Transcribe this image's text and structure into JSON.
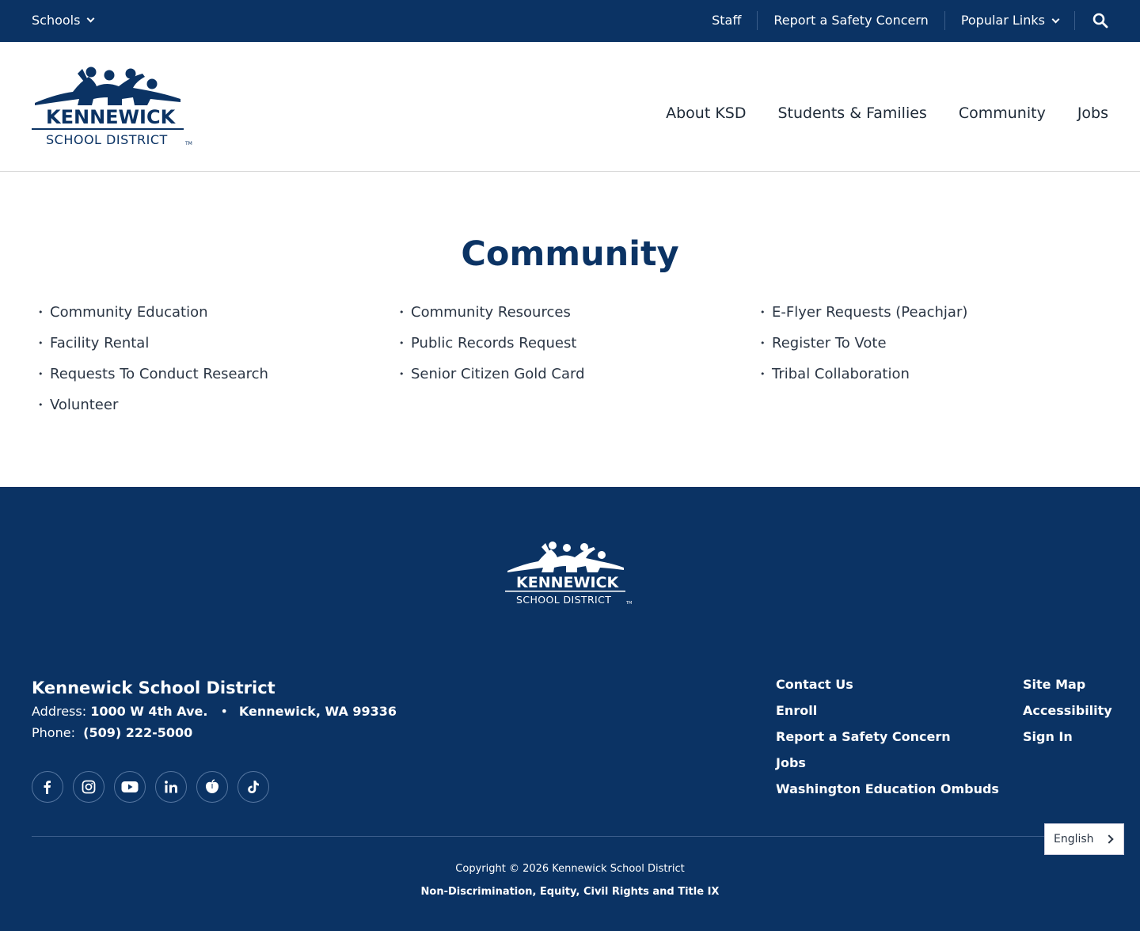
{
  "topbar": {
    "schools_label": "Schools",
    "utility_links": [
      "Staff",
      "Report a Safety Concern",
      "Popular Links"
    ],
    "search_icon": "search-icon"
  },
  "logo": {
    "line1": "KENNEWICK",
    "line2": "SCHOOL DISTRICT",
    "tm": "TM"
  },
  "main_nav": [
    "About KSD",
    "Students & Families",
    "Community",
    "Jobs"
  ],
  "page": {
    "title": "Community",
    "links": [
      "Community Education",
      "Community Resources",
      "E-Flyer Requests (Peachjar)",
      "Facility Rental",
      "Public Records Request",
      "Register To Vote",
      "Requests To Conduct Research",
      "Senior Citizen Gold Card",
      "Tribal Collaboration",
      "Volunteer"
    ]
  },
  "footer": {
    "district_name": "Kennewick School District",
    "address_label": "Address:",
    "address_street": "1000 W 4th Ave.",
    "address_city": "Kennewick, WA 99336",
    "phone_label": "Phone:",
    "phone": "(509) 222-5000",
    "social": [
      "facebook-icon",
      "instagram-icon",
      "youtube-icon",
      "linkedin-icon",
      "peachjar-icon",
      "tiktok-icon"
    ],
    "links_col1": [
      "Contact Us",
      "Enroll",
      "Report a Safety Concern",
      "Jobs",
      "Washington Education Ombuds"
    ],
    "links_col2": [
      "Site Map",
      "Accessibility",
      "Sign In"
    ],
    "copyright": "Copyright © 2026 Kennewick School District",
    "nondiscrimination": "Non-Discrimination, Equity, Civil Rights and Title IX",
    "language": "English"
  },
  "colors": {
    "navy": "#0b3364",
    "text": "#2b3645"
  }
}
